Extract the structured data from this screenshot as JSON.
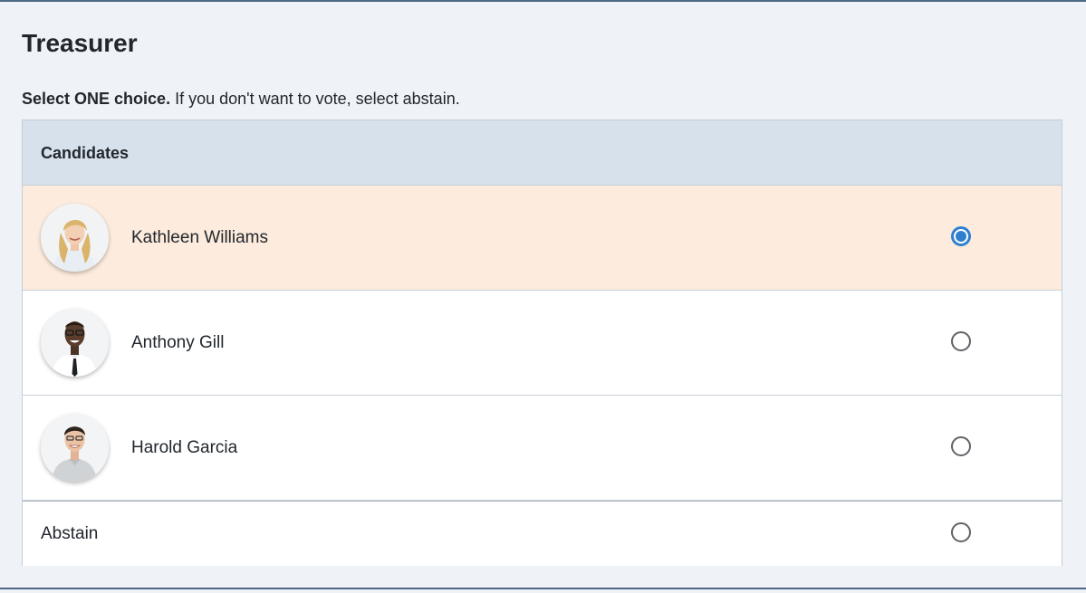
{
  "contest": {
    "title": "Treasurer",
    "instruction_bold": "Select ONE choice.",
    "instruction_rest": " If you don't want to vote, select abstain.",
    "column_header": "Candidates"
  },
  "candidates": [
    {
      "name": "Kathleen Williams",
      "selected": true
    },
    {
      "name": "Anthony Gill",
      "selected": false
    },
    {
      "name": "Harold Garcia",
      "selected": false
    }
  ],
  "abstain": {
    "label": "Abstain",
    "selected": false
  },
  "colors": {
    "selected_row": "#fdebdd",
    "radio_accent": "#2f7fd0",
    "header_bg": "#d7e1ec",
    "page_bg": "#eff3f8"
  }
}
